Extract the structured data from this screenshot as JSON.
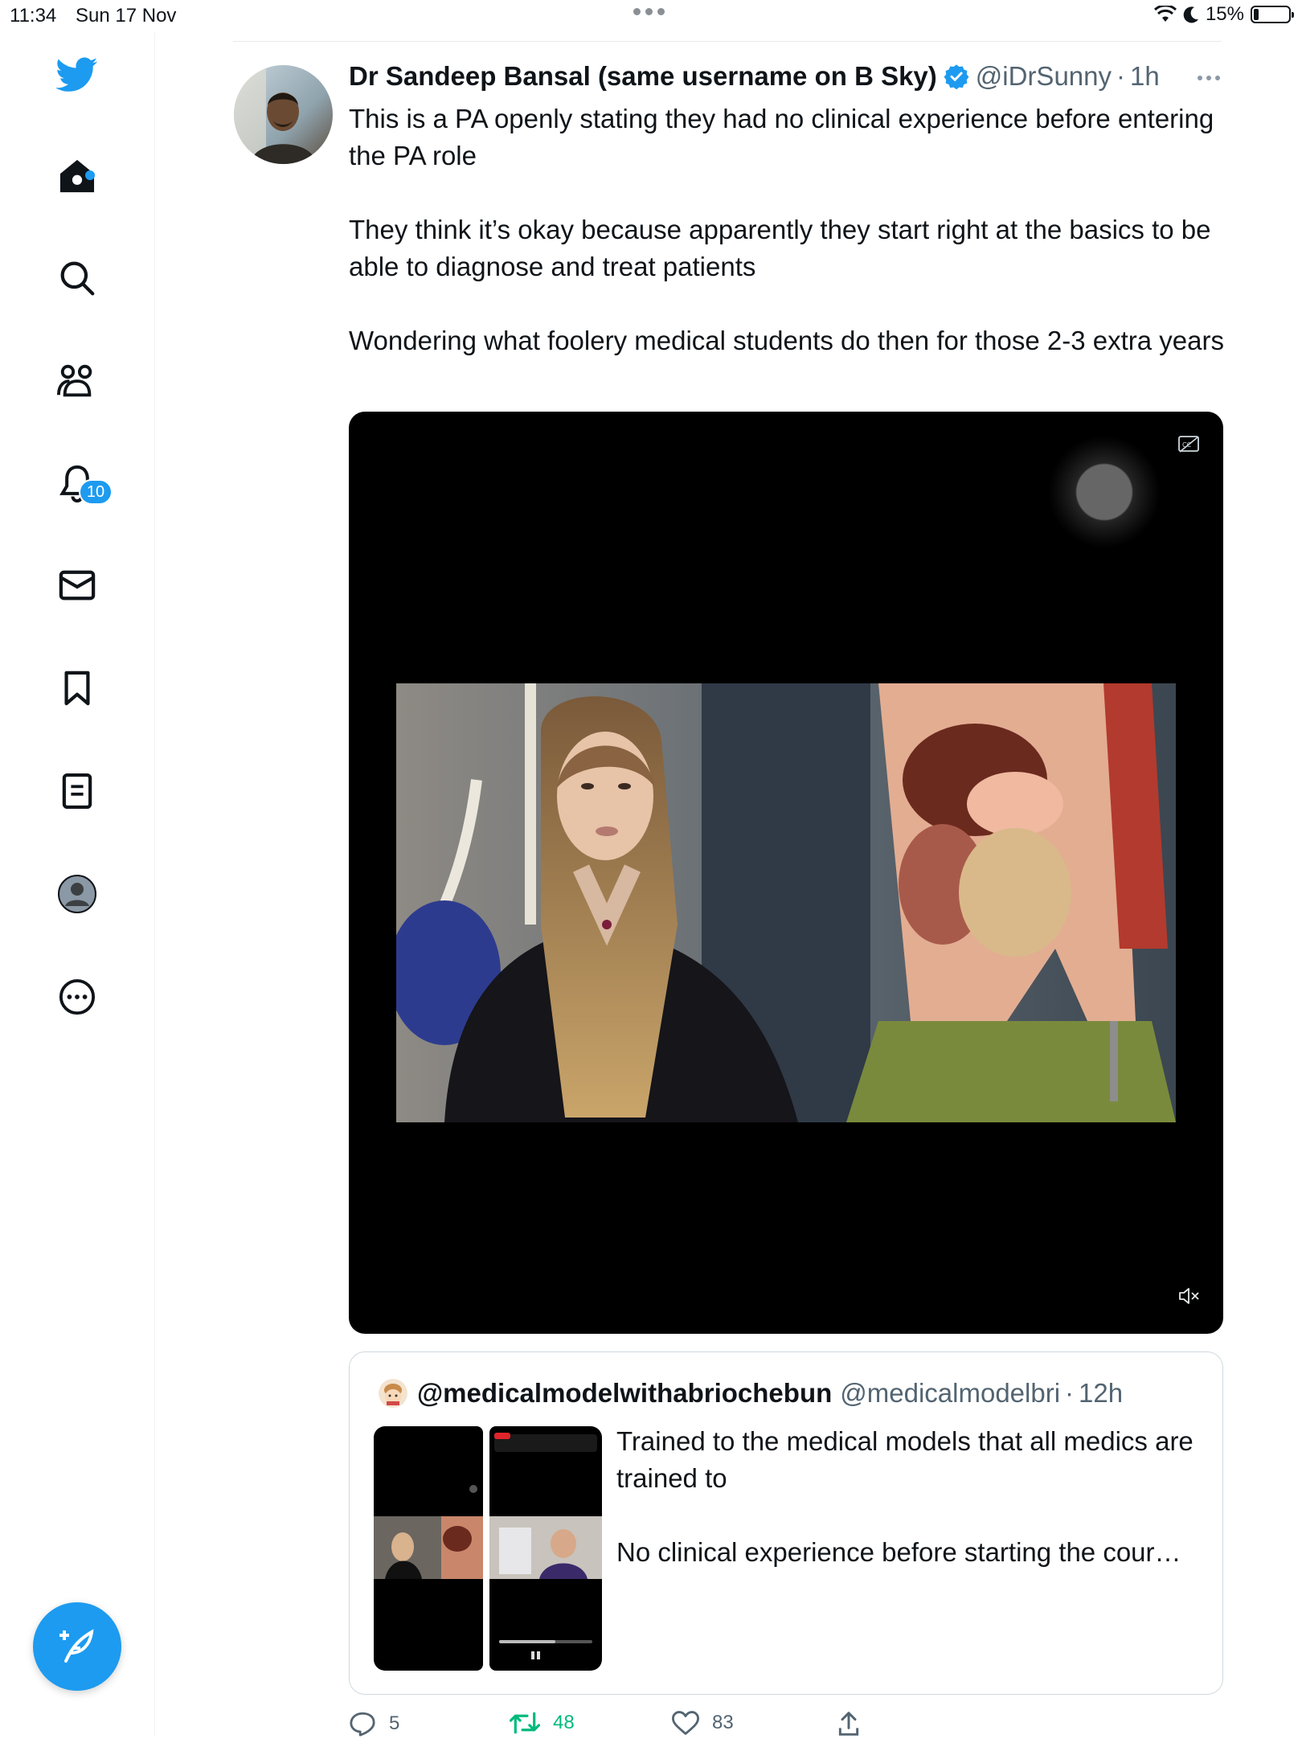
{
  "status_bar": {
    "time": "11:34",
    "date": "Sun 17 Nov",
    "battery": "15%"
  },
  "sidebar": {
    "notifications_badge": "10"
  },
  "tweet": {
    "author_name": "Dr Sandeep Bansal (same username on B Sky)",
    "handle": "@iDrSunny",
    "separator": "·",
    "time": "1h",
    "paragraphs": [
      "This is a PA openly stating they had no clinical experience before entering the PA role",
      "They think it’s okay because apparently they start right at the basics to be able to diagnose and treat patients",
      "Wondering what foolery medical students do then for those 2-3 extra years"
    ]
  },
  "quoted_tweet": {
    "author_name": "@medicalmodelwithabriochebun",
    "handle": "@medicalmodelbri",
    "separator": "·",
    "time": "12h",
    "paragraphs": [
      "Trained to the medical models that all medics are trained to",
      "No clinical experience before starting the cour…"
    ]
  },
  "actions": {
    "replies": "5",
    "retweets": "48",
    "likes": "83"
  },
  "colors": {
    "accent": "#1d9bf0",
    "retweet": "#00ba7c",
    "muted_text": "#536471"
  }
}
